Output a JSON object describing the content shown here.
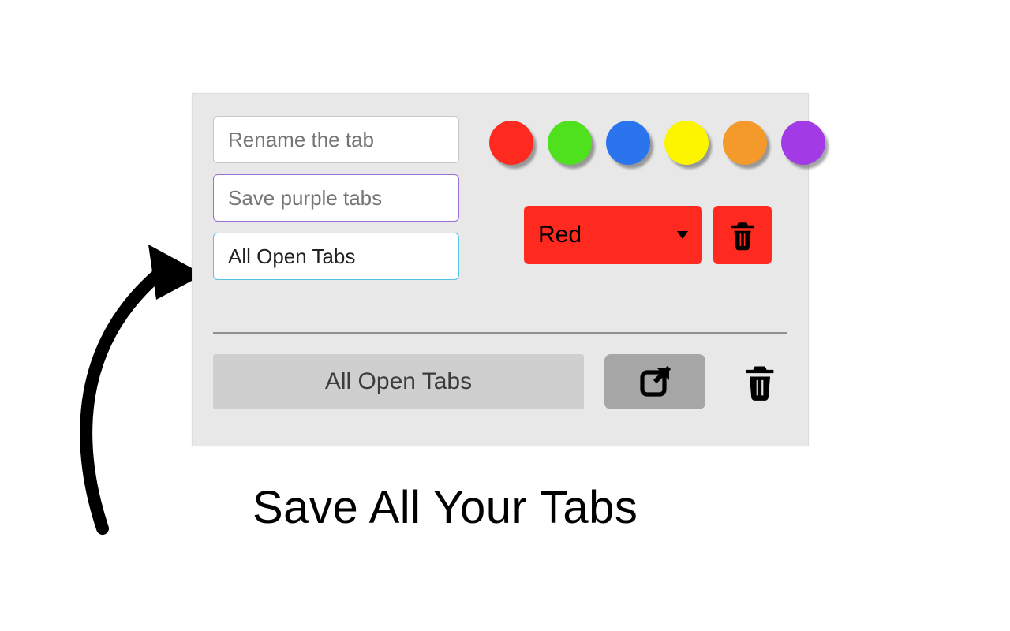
{
  "inputs": {
    "rename_placeholder": "Rename the tab",
    "save_placeholder": "Save purple tabs",
    "all_open_value": "All Open Tabs"
  },
  "swatches": [
    {
      "name": "red",
      "hex": "#ff2a1f"
    },
    {
      "name": "green",
      "hex": "#4fe01e"
    },
    {
      "name": "blue",
      "hex": "#2a74ee"
    },
    {
      "name": "yellow",
      "hex": "#fdf500"
    },
    {
      "name": "orange",
      "hex": "#f39a2b"
    },
    {
      "name": "purple",
      "hex": "#a23ae6"
    }
  ],
  "select": {
    "label": "Red"
  },
  "bottom": {
    "button_label": "All Open Tabs"
  },
  "caption": "Save All Your Tabs"
}
